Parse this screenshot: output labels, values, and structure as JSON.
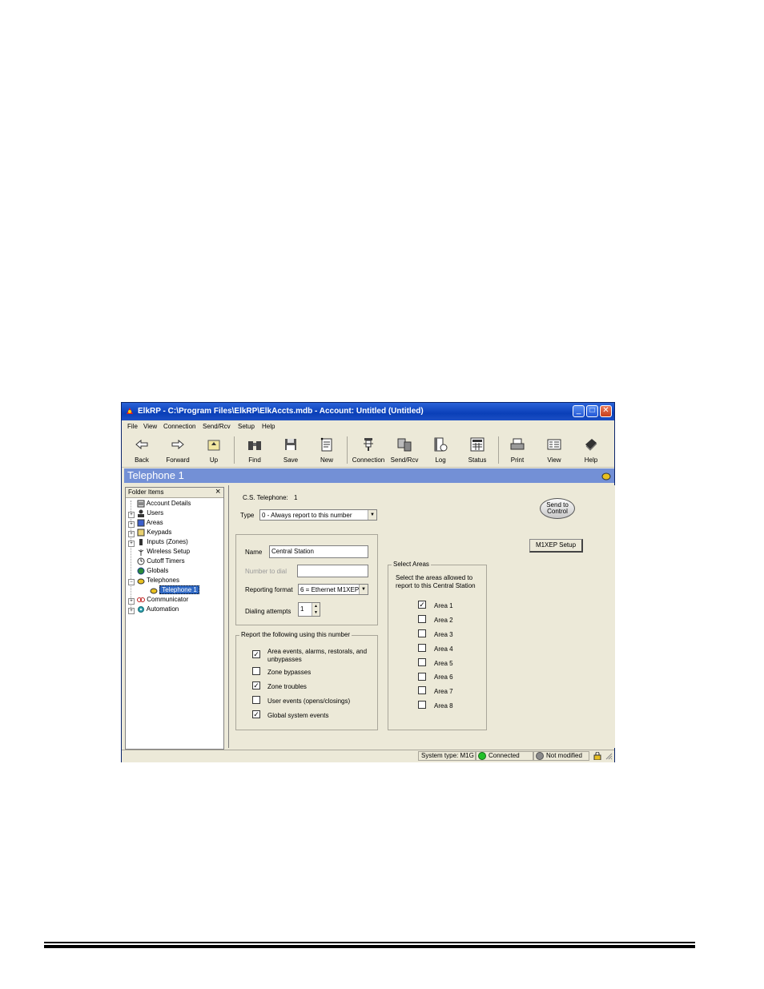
{
  "window": {
    "title": "ElkRP - C:\\Program Files\\ElkRP\\ElkAccts.mdb - Account: Untitled (Untitled)",
    "minimize": "_",
    "maximize": "□",
    "close": "✕"
  },
  "menu": [
    "File",
    "View",
    "Connection",
    "Send/Rcv",
    "Setup",
    "Help"
  ],
  "toolbar": {
    "back": "Back",
    "forward": "Forward",
    "up": "Up",
    "find": "Find",
    "save": "Save",
    "new": "New",
    "connection": "Connection",
    "sendrcv": "Send/Rcv",
    "log": "Log",
    "status": "Status",
    "print": "Print",
    "view": "View",
    "help": "Help"
  },
  "header": {
    "title": "Telephone 1"
  },
  "folder_pane": {
    "title": "Folder Items",
    "close": "×",
    "items": [
      "Account Details",
      "Users",
      "Areas",
      "Keypads",
      "Inputs (Zones)",
      "Wireless Setup",
      "Cutoff Timers",
      "Globals",
      "Telephones",
      "Telephone 1",
      "Communicator",
      "Automation"
    ]
  },
  "form": {
    "cs_telephone_label": "C.S. Telephone:",
    "cs_telephone_value": "1",
    "type_label": "Type",
    "type_value": "0 - Always report to this number",
    "send_to_control": "Send to Control",
    "m1xep_setup": "M1XEP Setup",
    "name_label": "Name",
    "name_value": "Central Station",
    "number_label": "Number to dial",
    "number_value": "",
    "reporting_format_label": "Reporting format",
    "reporting_format_value": "6 = Ethernet M1XEP",
    "dialing_attempts_label": "Dialing attempts",
    "dialing_attempts_value": "1",
    "report_group_title": "Report the following using this number",
    "report_options": [
      {
        "label": "Area events, alarms, restorals, and unbypasses",
        "checked": true
      },
      {
        "label": "Zone bypasses",
        "checked": false
      },
      {
        "label": "Zone troubles",
        "checked": true
      },
      {
        "label": "User events (opens/closings)",
        "checked": false
      },
      {
        "label": "Global system events",
        "checked": true
      }
    ],
    "areas_group_title": "Select Areas",
    "areas_description": "Select the areas allowed to report to this Central Station",
    "areas": [
      {
        "label": "Area 1",
        "checked": true
      },
      {
        "label": "Area 2",
        "checked": false
      },
      {
        "label": "Area 3",
        "checked": false
      },
      {
        "label": "Area 4",
        "checked": false
      },
      {
        "label": "Area 5",
        "checked": false
      },
      {
        "label": "Area 6",
        "checked": false
      },
      {
        "label": "Area 7",
        "checked": false
      },
      {
        "label": "Area 8",
        "checked": false
      }
    ],
    "check_mark": "✓"
  },
  "status": {
    "system_type": "System type: M1G",
    "connected": "Connected",
    "modified": "Not modified"
  },
  "colors": {
    "titlebar": "#0a3fb8",
    "headerbar": "#7390d6",
    "connected": "#22c02a",
    "not_modified": "#8a8a8a"
  }
}
